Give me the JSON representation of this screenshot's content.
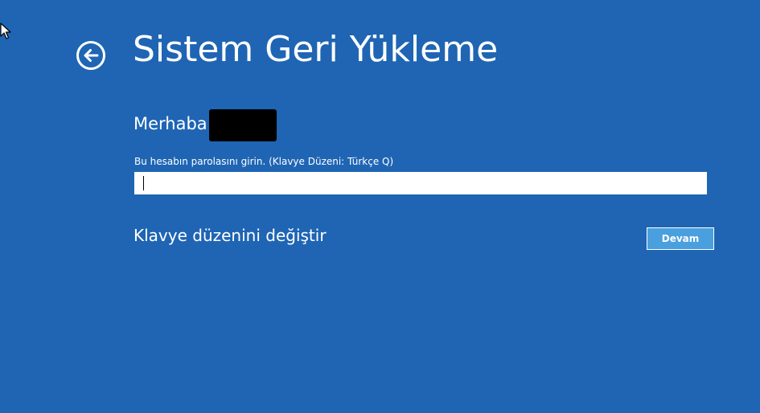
{
  "screen": {
    "title": "Sistem Geri Yükleme"
  },
  "account": {
    "greeting": "Merhaba",
    "username_redacted": true
  },
  "password_field": {
    "label": "Bu hesabın parolasını girin. (Klavye Düzeni: Türkçe Q)",
    "value": "",
    "focused": true
  },
  "actions": {
    "change_keyboard_label": "Klavye düzenini değiştir",
    "continue_label": "Devam"
  },
  "icons": {
    "back": "back-arrow-circle-icon",
    "cursor": "mouse-pointer-icon"
  },
  "colors": {
    "background": "#1f65b4",
    "text": "#ffffff",
    "input_background": "#ffffff",
    "button_fill": "#4a9fdf",
    "button_border": "#ffffff",
    "redaction": "#000000"
  }
}
